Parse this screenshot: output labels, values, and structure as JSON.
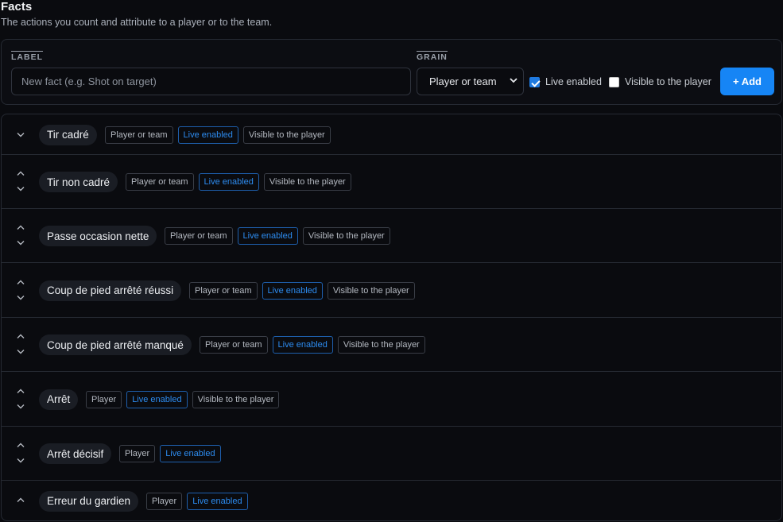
{
  "header": {
    "title": "Facts",
    "subtitle": "The actions you count and attribute to a player or to the team."
  },
  "form": {
    "label_heading": "LABEL",
    "label_placeholder": "New fact (e.g. Shot on target)",
    "grain_heading": "GRAIN",
    "grain_value": "Player or team",
    "live_enabled_label": "Live enabled",
    "live_enabled_checked": true,
    "visible_label": "Visible to the player",
    "visible_checked": false,
    "add_label": "+ Add"
  },
  "colors": {
    "accent": "#1685f5",
    "live_badge": "#2d8cf0",
    "background": "#0a0b0f"
  },
  "facts": [
    {
      "name": "Tir cadré",
      "grain": "Player or team",
      "live": "Live enabled",
      "visible": "Visible to the player",
      "can_move_up": false,
      "can_move_down": true
    },
    {
      "name": "Tir non cadré",
      "grain": "Player or team",
      "live": "Live enabled",
      "visible": "Visible to the player",
      "can_move_up": true,
      "can_move_down": true
    },
    {
      "name": "Passe occasion nette",
      "grain": "Player or team",
      "live": "Live enabled",
      "visible": "Visible to the player",
      "can_move_up": true,
      "can_move_down": true
    },
    {
      "name": "Coup de pied arrêté réussi",
      "grain": "Player or team",
      "live": "Live enabled",
      "visible": "Visible to the player",
      "can_move_up": true,
      "can_move_down": true
    },
    {
      "name": "Coup de pied arrêté manqué",
      "grain": "Player or team",
      "live": "Live enabled",
      "visible": "Visible to the player",
      "can_move_up": true,
      "can_move_down": true
    },
    {
      "name": "Arrêt",
      "grain": "Player",
      "live": "Live enabled",
      "visible": "Visible to the player",
      "can_move_up": true,
      "can_move_down": true
    },
    {
      "name": "Arrêt décisif",
      "grain": "Player",
      "live": "Live enabled",
      "visible": "",
      "can_move_up": true,
      "can_move_down": true
    },
    {
      "name": "Erreur du gardien",
      "grain": "Player",
      "live": "Live enabled",
      "visible": "",
      "can_move_up": true,
      "can_move_down": false
    }
  ],
  "icons": {
    "move_up": "chevron-up-icon",
    "move_down": "chevron-down-icon"
  }
}
